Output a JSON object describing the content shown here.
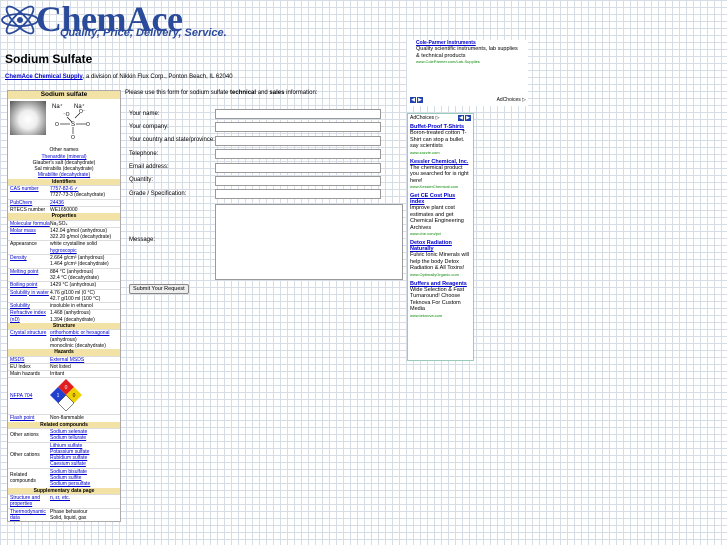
{
  "header": {
    "logo": "ChemAce",
    "tagline": "Quality, Price, Delivery, Service."
  },
  "page": {
    "title": "Sodium Sulfate",
    "company_link": "ChemAce Chemical Supply",
    "company_rest": ", a division of Nikkin Flux Corp., Ponton Beach, IL 62040"
  },
  "infobox": {
    "name": "Sodium sulfate",
    "other_names_label": "Other names",
    "other_names": [
      "Thenardite (mineral)",
      "Glauber's salt (decahydrate)",
      "Sal mirabilis (decahydrate)",
      "Mirabilite (decahydrate)"
    ],
    "sections": {
      "identifiers": "Identifiers",
      "properties": "Properties",
      "structure": "Structure",
      "hazards": "Hazards",
      "related": "Related compounds",
      "supplementary": "Supplementary data page"
    },
    "identifiers": [
      {
        "k": "CAS number",
        "v": "7757-82-6 ✓",
        "v2": "7727-73-3 (decahydrate)"
      },
      {
        "k": "PubChem",
        "v": "24436",
        "v2": ""
      },
      {
        "k": "RTECS number",
        "v": "WE1650000",
        "v2": ""
      }
    ],
    "properties": [
      {
        "k": "Molecular formula",
        "v": "Na₂SO₄",
        "v2": ""
      },
      {
        "k": "Molar mass",
        "v": "142.04 g/mol (anhydrous)",
        "v2": "322.20 g/mol (decahydrate)"
      },
      {
        "k": "Appearance",
        "v": "white crystalline solid",
        "v2": "hygroscopic"
      },
      {
        "k": "Density",
        "v": "2.664 g/cm³ (anhydrous)",
        "v2": "1.464 g/cm³ (decahydrate)"
      },
      {
        "k": "Melting point",
        "v": "884 °C (anhydrous)",
        "v2": "32.4 °C (decahydrate)"
      },
      {
        "k": "Boiling point",
        "v": "1429 °C (anhydrous)",
        "v2": ""
      },
      {
        "k": "Solubility in water",
        "v": "4.76 g/100 ml (0 °C)",
        "v2": "42.7 g/100 ml (100 °C)"
      },
      {
        "k": "Solubility",
        "v": "insoluble in ethanol",
        "v2": ""
      },
      {
        "k": "Refractive index (nD)",
        "v": "1.468 (anhydrous)",
        "v2": "1.394 (decahydrate)"
      }
    ],
    "structure": [
      {
        "k": "Crystal structure",
        "v": "orthorhombic or hexagonal",
        "v2": "(anhydrous)",
        "v3": "monoclinic (decahydrate)"
      }
    ],
    "hazards": [
      {
        "k": "MSDS",
        "v": "External MSDS"
      },
      {
        "k": "EU Index",
        "v": "Not listed"
      },
      {
        "k": "Main hazards",
        "v": "Irritant"
      },
      {
        "k": "NFPA 704",
        "v": ""
      },
      {
        "k": "Flash point",
        "v": "Non-flammable"
      }
    ],
    "nfpa": {
      "health": "1",
      "fire": "0",
      "reactivity": "0"
    },
    "related": [
      {
        "k": "Other anions",
        "v": [
          "Sodium selenate",
          "Sodium tellurate"
        ]
      },
      {
        "k": "Other cations",
        "v": [
          "Lithium sulfate",
          "Potassium sulfate",
          "Rubidium sulfate",
          "Caesium sulfate"
        ]
      },
      {
        "k": "Related compounds",
        "v": [
          "Sodium bisulfate",
          "Sodium sulfite",
          "Sodium persulfate"
        ]
      }
    ],
    "supplementary": [
      {
        "k": "Structure and properties",
        "v": "n, εr, etc."
      },
      {
        "k": "Thermodynamic data",
        "v": "Phase behaviour",
        "v2": "Solid, liquid, gas"
      }
    ]
  },
  "form": {
    "intro_pre": "Please use this form for sodium sulfate ",
    "intro_bold1": "technical",
    "intro_mid": " and ",
    "intro_bold2": "sales",
    "intro_post": " information:",
    "fields": [
      "Your name:",
      "Your company:",
      "Your country and state/province:",
      "Telephone:",
      "Email address:",
      "Quantity:",
      "Grade / Specification:"
    ],
    "message_label": "Message:",
    "submit": "Submit Your Request"
  },
  "ad_top": {
    "title": "Cole-Parmer Instruments",
    "desc": [
      "Quality scientific instruments, lab supplies",
      "& technical products"
    ],
    "url": "www.ColeParmer.com/Lab-Supplies",
    "adchoices": "AdChoices ▷"
  },
  "ad_side": {
    "adchoices": "AdChoices ▷",
    "items": [
      {
        "h": "Buffet-Proof T-Shirts",
        "d": "Boron-treated cotton T-Shirt can stop a bullet. say scientists",
        "u": "www.zazzle.com"
      },
      {
        "h": "Kessler Chemical, Inc.",
        "d": "The chemical product you searched for is right here!",
        "u": "www.KesslerChemical.com"
      },
      {
        "h": "Get CE Cost Plus index",
        "d": "Improve plant cost estimates and get Chemical Engineering Archives",
        "u": "www.che.com/pci"
      },
      {
        "h": "Detox Radiation Naturally",
        "d": "Fulvic Ionic Minerals will help the body Detox Radiation & All Toxins!",
        "u": "www.OptimallyOrganic.com"
      },
      {
        "h": "Buffers and Reagents",
        "d": "Wide Selection & Fast Turnaround! Choose Teknova For Custom Media",
        "u": "www.teknova.com"
      }
    ]
  },
  "colors": {
    "brand": "#2a4a9a",
    "infobox_header": "#f2e2a6",
    "link": "#0000cc",
    "ad_url": "#0a8a0a"
  }
}
